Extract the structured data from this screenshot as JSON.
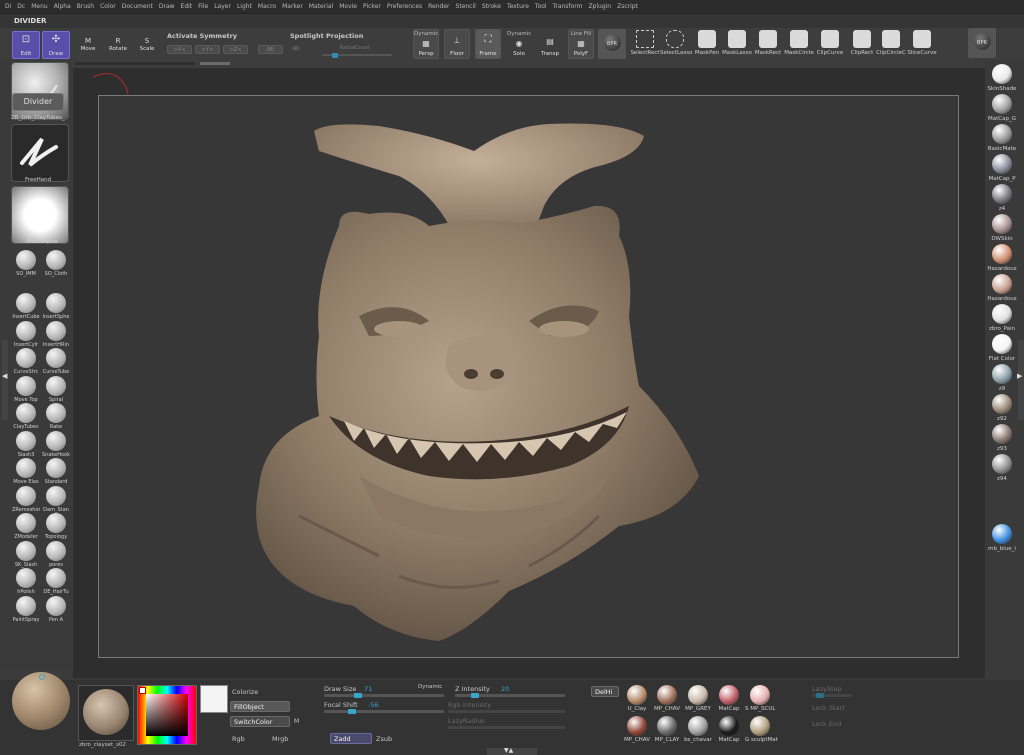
{
  "menu": [
    "Di",
    "Dc",
    "Menu",
    "Alpha",
    "Brush",
    "Color",
    "Document",
    "Draw",
    "Edit",
    "File",
    "Layer",
    "Light",
    "Macro",
    "Marker",
    "Material",
    "Movie",
    "Picker",
    "Preferences",
    "Render",
    "Stencil",
    "Stroke",
    "Texture",
    "Tool",
    "Transform",
    "Zplugin",
    "Zscript"
  ],
  "palette_title": "DIVIDER",
  "toolbar": {
    "edit": "Edit",
    "draw": "Draw",
    "move": "Move",
    "rotate": "Rotate",
    "scale": "Scale",
    "activate_symmetry": "Activate Symmetry",
    "sym_x": ">X<",
    "sym_y": ">Y<",
    "sym_z": ">Z<",
    "sym_m": "(M)",
    "sym_r": "(R)",
    "spotlight": "Spotlight Projection",
    "radial_count": "RadialCount",
    "persp_top": "Dynamic",
    "persp": "Persp",
    "floor": "Floor",
    "frame": "Frame",
    "solo_top": "Dynamic",
    "solo": "Solo",
    "transp": "Transp",
    "polyf_top": "Line Fill",
    "polyf": "PolyF",
    "brush_label": "BPR",
    "right_btn": "BPR"
  },
  "mask_buttons": [
    "SelectRect",
    "SelectLasso",
    "MaskPen",
    "MaskLasso",
    "MaskRect",
    "MaskCircle",
    "ClipCurve",
    "ClipRect",
    "ClipCircleC",
    "SliceCurve"
  ],
  "left": {
    "brush_name": "Divider",
    "brush_sub": "ZB_Orb_ClayTubes_",
    "stroke": "FreeHand",
    "alpha": "BrushAlpha",
    "row1": [
      "SO_IMM",
      "SO_Cloth"
    ],
    "brushes": [
      [
        "InsertCube",
        "InsertSphe"
      ],
      [
        "InsertCylr",
        "InsertHRin"
      ],
      [
        "CurveStrc",
        "CurveTube"
      ],
      [
        "Move Top",
        "Spiral"
      ],
      [
        "ClayTubes",
        "Rake"
      ],
      [
        "Slash3",
        "SnakeHook"
      ],
      [
        "Move Elas",
        "Standard"
      ],
      [
        "ZRemesher",
        "Dam_Stan"
      ],
      [
        "ZModeler",
        "Topology"
      ],
      [
        "SK_Slash",
        "pores"
      ],
      [
        "hPolish",
        "DE_HairTu"
      ],
      [
        "PaintSpray",
        "Pen A"
      ]
    ]
  },
  "right_materials": [
    {
      "name": "SkinShade",
      "color": "#e8e8e8"
    },
    {
      "name": "MatCap_G",
      "color": "#a0a0a0"
    },
    {
      "name": "BasicMate",
      "color": "#9a9a9a"
    },
    {
      "name": "MatCap_P",
      "color": "#8a8a9a"
    },
    {
      "name": "z4",
      "color": "#7a7a80"
    },
    {
      "name": "DWSkin",
      "color": "#a89090"
    },
    {
      "name": "Hazardous",
      "color": "#d09070"
    },
    {
      "name": "Hazardous",
      "color": "#c8a090"
    },
    {
      "name": "zbro_Pain",
      "color": "#e0e0e0"
    },
    {
      "name": "Flat Color",
      "color": "#f4f4f4"
    },
    {
      "name": "z9",
      "color": "#8aa0a8"
    },
    {
      "name": "z92",
      "color": "#9a8a78"
    },
    {
      "name": "z93",
      "color": "#8a7a72"
    },
    {
      "name": "z94",
      "color": "#909090"
    },
    {
      "name": "mb_blue_i",
      "color": "#3f8fe0"
    }
  ],
  "bottom": {
    "material_name": "zbro_clayset_s02",
    "colorize": "Colorize",
    "fill_object": "FillObject",
    "switch_color": "SwitchColor",
    "m": "M",
    "rgb": "Rgb",
    "mrgb": "Mrgb",
    "zadd": "Zadd",
    "zsub": "Zsub",
    "draw_size_label": "Draw Size",
    "draw_size": "71",
    "dynamic": "Dynamic",
    "focal_shift_label": "Focal Shift",
    "focal_shift": "-56",
    "z_intensity_label": "Z Intensity",
    "z_intensity": "20",
    "rgb_intensity": "Rgb Intensity",
    "lazy_radius": "LazyRadius",
    "delhi": "DelHi",
    "lazy_step": "LazyStep",
    "lock_start": "Lock Start",
    "lock_end": "Lock End",
    "materials_top": [
      {
        "name": "U_Clay",
        "color": "#b88a6a"
      },
      {
        "name": "MP_CHAV",
        "color": "#a0705a"
      },
      {
        "name": "MP_GREY",
        "color": "#c8b8a8"
      },
      {
        "name": "MatCap",
        "color": "#c06068"
      },
      {
        "name": "S MP_SCUL",
        "color": "#e8b0b0"
      }
    ],
    "materials_bottom": [
      {
        "name": "MP_CHAV",
        "color": "#904838"
      },
      {
        "name": "MP_CLAY",
        "color": "#6a6a6a"
      },
      {
        "name": "bs_chavar",
        "color": "#a0a0a0"
      },
      {
        "name": "MatCap",
        "color": "#1a1a1a"
      },
      {
        "name": "G sculptMat",
        "color": "#b0a080"
      }
    ]
  },
  "colors": {
    "accent_blue": "#36a6c9",
    "active_button": "#5a4fa8",
    "model_clay": "#9a8672"
  }
}
